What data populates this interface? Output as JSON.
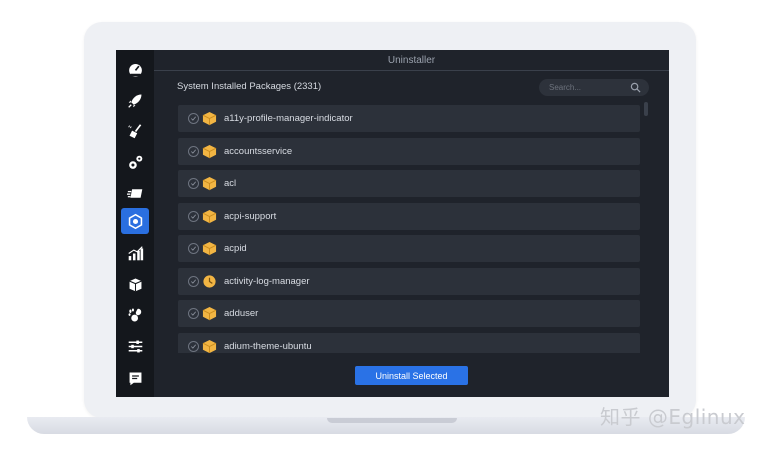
{
  "app": {
    "title": "Uninstaller"
  },
  "sidebar": {
    "items": [
      {
        "icon": "dashboard-icon"
      },
      {
        "icon": "rocket-icon"
      },
      {
        "icon": "broom-icon"
      },
      {
        "icon": "gears-icon"
      },
      {
        "icon": "fast-forward-icon"
      },
      {
        "icon": "uninstaller-package-icon",
        "active": true
      },
      {
        "icon": "chart-icon"
      },
      {
        "icon": "box-icon"
      },
      {
        "icon": "gnome-icon"
      },
      {
        "icon": "sliders-icon"
      },
      {
        "icon": "log-icon"
      }
    ]
  },
  "header": {
    "packages_label": "System Installed Packages (2331)",
    "search_placeholder": "Search..."
  },
  "packages": [
    {
      "name": "a11y-profile-manager-indicator",
      "icon": "package-icon"
    },
    {
      "name": "accountsservice",
      "icon": "package-icon"
    },
    {
      "name": "acl",
      "icon": "package-icon"
    },
    {
      "name": "acpi-support",
      "icon": "package-icon"
    },
    {
      "name": "acpid",
      "icon": "package-icon"
    },
    {
      "name": "activity-log-manager",
      "icon": "activity-icon"
    },
    {
      "name": "adduser",
      "icon": "package-icon"
    },
    {
      "name": "adium-theme-ubuntu",
      "icon": "package-icon"
    }
  ],
  "actions": {
    "uninstall_label": "Uninstall Selected"
  },
  "watermark": "知乎 @Eglinux",
  "colors": {
    "accent": "#2a72e6",
    "background": "#1f232b",
    "row": "#2c313a",
    "sidebar": "#14171c"
  }
}
